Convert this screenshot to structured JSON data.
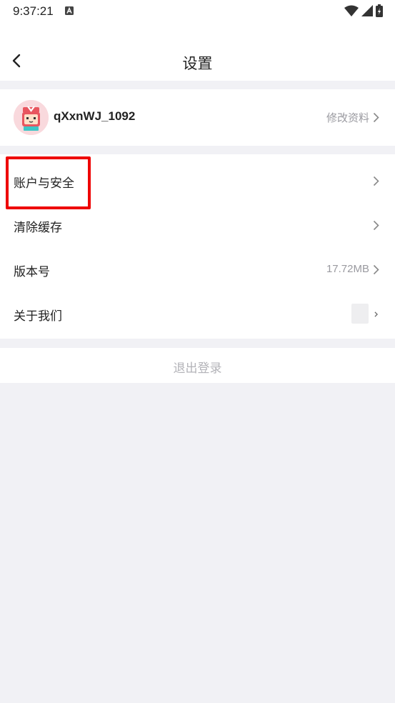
{
  "status_bar": {
    "time": "9:37:21",
    "icons": [
      "a-notification-icon",
      "wifi-icon",
      "signal-icon",
      "battery-icon"
    ]
  },
  "header": {
    "title": "设置",
    "back_icon": "chevron-left-icon"
  },
  "profile": {
    "username": "qXxnWJ_1092",
    "edit_label": "修改资料",
    "avatar_colors": {
      "bg": "#f9d9dd",
      "hair": "#e8565f",
      "face": "#ffe0c8"
    }
  },
  "menu": [
    {
      "label": "账户与安全",
      "value": ""
    },
    {
      "label": "清除缓存",
      "value": ""
    },
    {
      "label": "版本号",
      "value": "17.72MB"
    },
    {
      "label": "关于我们",
      "value": ""
    }
  ],
  "logout": {
    "label": "退出登录"
  },
  "colors": {
    "page_bg": "#f1f1f5",
    "card_bg": "#ffffff",
    "text_primary": "#222222",
    "text_secondary": "#9a9aa0",
    "logout_text": "#b3b3b8",
    "highlight": "#ee0000"
  }
}
